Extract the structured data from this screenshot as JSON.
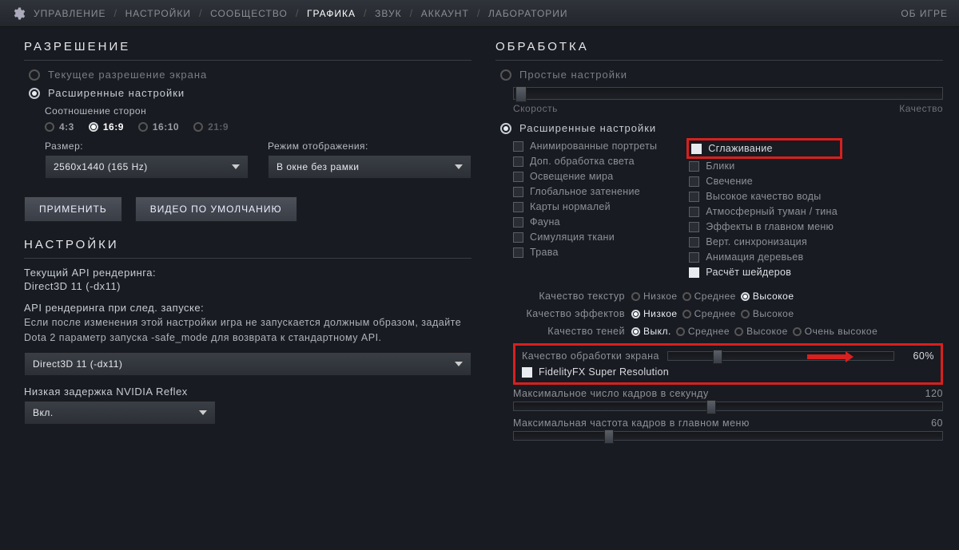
{
  "tabs": [
    "УПРАВЛЕНИЕ",
    "НАСТРОЙКИ",
    "СООБЩЕСТВО",
    "ГРАФИКА",
    "ЗВУК",
    "АККАУНТ",
    "ЛАБОРАТОРИИ"
  ],
  "tabs_active": 3,
  "about_label": "ОБ ИГРЕ",
  "resolution_title": "РАЗРЕШЕНИЕ",
  "res_current": "Текущее разрешение экрана",
  "res_advanced": "Расширенные настройки",
  "aspect_label": "Соотношение сторон",
  "aspect_opts": [
    "4:3",
    "16:9",
    "16:10",
    "21:9"
  ],
  "aspect_sel": 1,
  "size_label": "Размер:",
  "size_value": "2560x1440 (165 Hz)",
  "mode_label": "Режим отображения:",
  "mode_value": "В окне без рамки",
  "apply_btn": "ПРИМЕНИТЬ",
  "default_btn": "ВИДЕО ПО УМОЛЧАНИЮ",
  "settings_title": "НАСТРОЙКИ",
  "api_current_label": "Текущий API рендеринга:",
  "api_current_value": "Direct3D 11 (-dx11)",
  "api_next_label": "API рендеринга при след. запуске:",
  "api_note": "Если после изменения этой настройки игра не запускается должным образом, задайте Dota 2 параметр запуска -safe_mode для возврата к стандартному API.",
  "api_select": "Direct3D 11 (-dx11)",
  "reflex_label": "Низкая задержка NVIDIA Reflex",
  "reflex_value": "Вкл.",
  "render_title": "ОБРАБОТКА",
  "render_simple": "Простые настройки",
  "slider_left": "Скорость",
  "slider_right": "Качество",
  "render_advanced": "Расширенные настройки",
  "chk_left": [
    "Анимированные портреты",
    "Доп. обработка света",
    "Освещение мира",
    "Глобальное затенение",
    "Карты нормалей",
    "Фауна",
    "Симуляция ткани",
    "Трава"
  ],
  "chk_right": [
    "Сглаживание",
    "Блики",
    "Свечение",
    "Высокое качество воды",
    "Атмосферный туман / тина",
    "Эффекты в главном меню",
    "Верт. синхронизация",
    "Анимация деревьев",
    "Расчёт шейдеров"
  ],
  "chk_right_sel": [
    0,
    8
  ],
  "q_texture_label": "Качество текстур",
  "q_effects_label": "Качество эффектов",
  "q_shadow_label": "Качество теней",
  "q_opts3": [
    "Низкое",
    "Среднее",
    "Высокое"
  ],
  "q_opts4": [
    "Выкл.",
    "Среднее",
    "Высокое",
    "Очень высокое"
  ],
  "q_texture_sel": 2,
  "q_effects_sel": 0,
  "q_shadow_sel": 0,
  "render_quality_label": "Качество обработки экрана",
  "render_quality_value": "60%",
  "fsr_label": "FidelityFX Super Resolution",
  "fps_label": "Максимальное число кадров в секунду",
  "fps_value": "120",
  "menu_fps_label": "Максимальная частота кадров в главном меню",
  "menu_fps_value": "60"
}
